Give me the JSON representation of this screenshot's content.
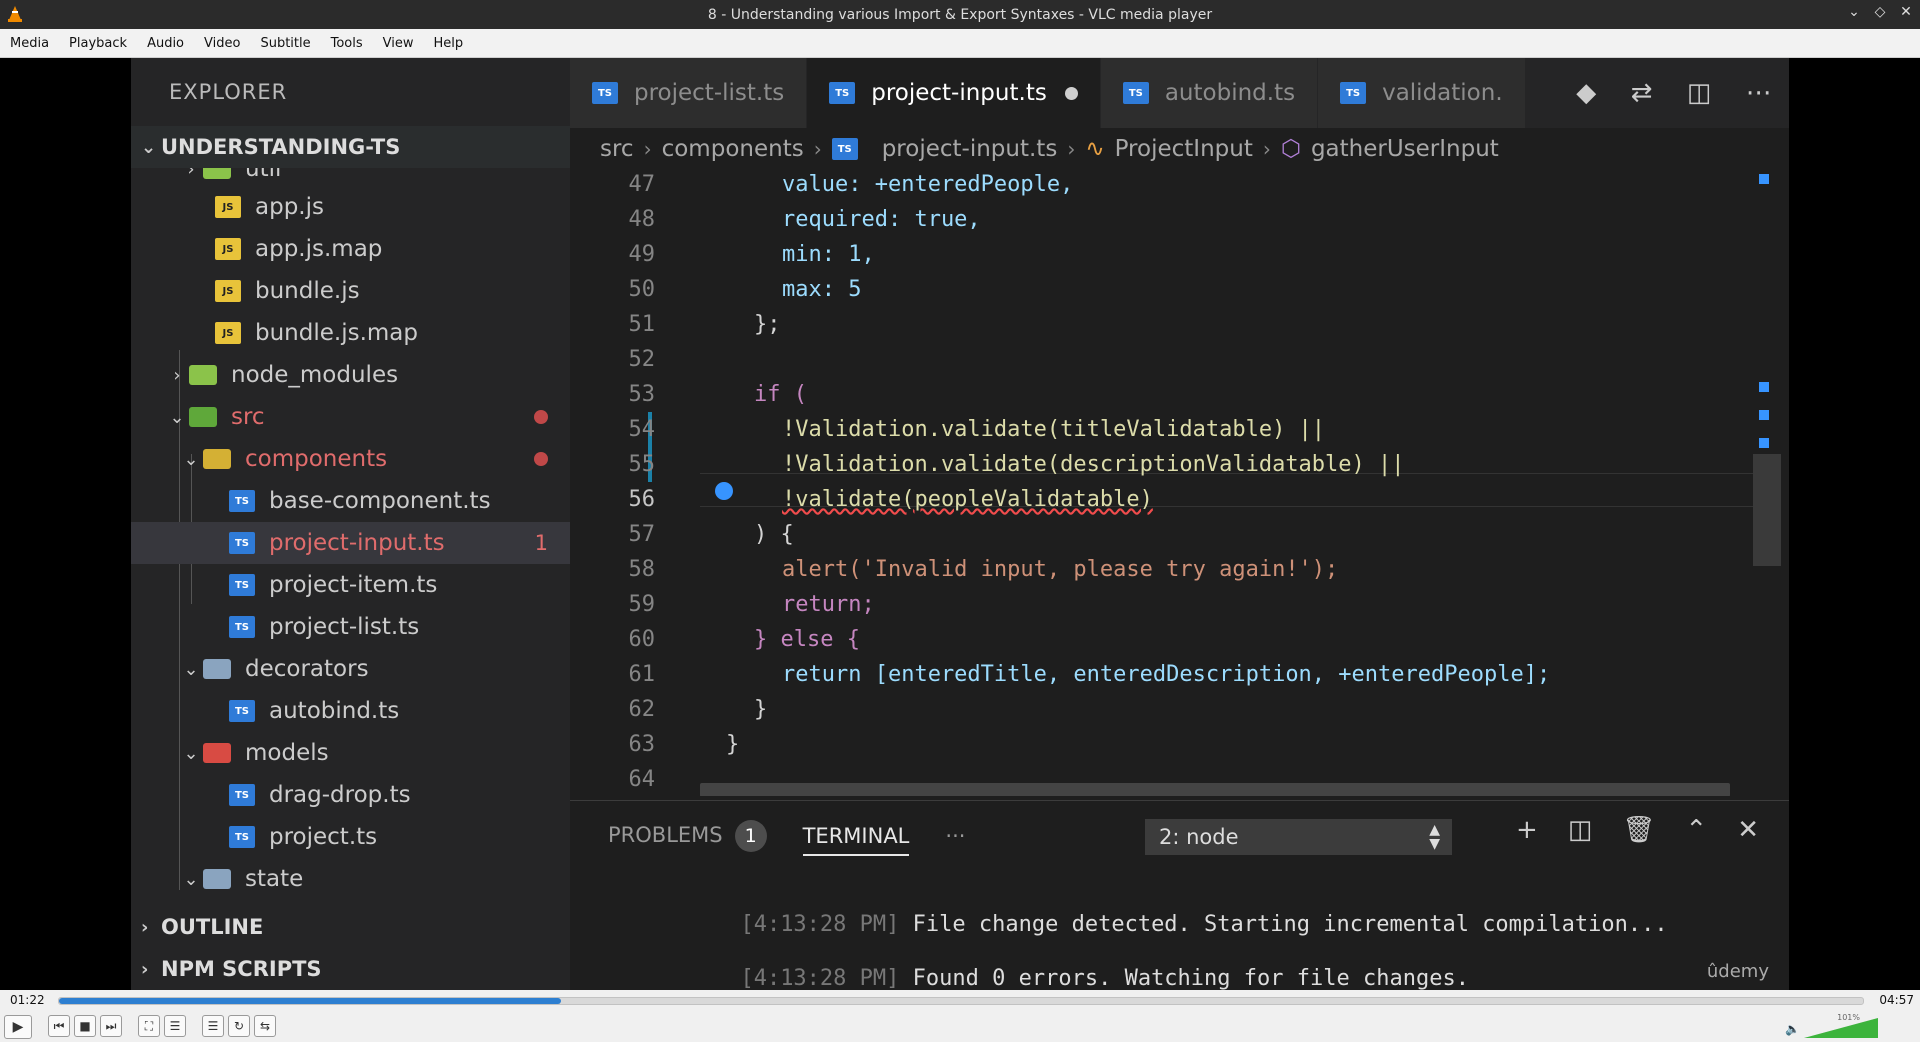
{
  "window": {
    "title": "8 - Understanding various Import & Export Syntaxes - VLC media player",
    "controls": [
      "⌄",
      "◇",
      "✕"
    ]
  },
  "menu": [
    "Media",
    "Playback",
    "Audio",
    "Video",
    "Subtitle",
    "Tools",
    "View",
    "Help"
  ],
  "explorer": {
    "title": "EXPLORER",
    "project": "UNDERSTANDING-TS",
    "items": [
      {
        "label": "util",
        "type": "folder"
      },
      {
        "label": "app.js",
        "type": "js"
      },
      {
        "label": "app.js.map",
        "type": "js"
      },
      {
        "label": "bundle.js",
        "type": "js"
      },
      {
        "label": "bundle.js.map",
        "type": "js"
      },
      {
        "label": "node_modules",
        "type": "folder"
      },
      {
        "label": "src",
        "type": "folder"
      },
      {
        "label": "components",
        "type": "folder"
      },
      {
        "label": "base-component.ts",
        "type": "ts"
      },
      {
        "label": "project-input.ts",
        "type": "ts",
        "errors": "1"
      },
      {
        "label": "project-item.ts",
        "type": "ts"
      },
      {
        "label": "project-list.ts",
        "type": "ts"
      },
      {
        "label": "decorators",
        "type": "folder"
      },
      {
        "label": "autobind.ts",
        "type": "ts"
      },
      {
        "label": "models",
        "type": "folder"
      },
      {
        "label": "drag-drop.ts",
        "type": "ts"
      },
      {
        "label": "project.ts",
        "type": "ts"
      },
      {
        "label": "state",
        "type": "folder"
      }
    ],
    "outline": "OUTLINE",
    "npm_scripts": "NPM SCRIPTS"
  },
  "tabs": [
    {
      "label": "project-list.ts",
      "active": false
    },
    {
      "label": "project-input.ts",
      "active": true
    },
    {
      "label": "autobind.ts",
      "active": false
    },
    {
      "label": "validation.",
      "active": false
    }
  ],
  "icon_labels": {
    "ts": "TS",
    "js": "JS"
  },
  "breadcrumb": [
    "src",
    "components",
    "project-input.ts",
    "ProjectInput",
    "gatherUserInput"
  ],
  "code": {
    "line_numbers": [
      "47",
      "48",
      "49",
      "50",
      "51",
      "52",
      "53",
      "54",
      "55",
      "56",
      "57",
      "58",
      "59",
      "60",
      "61",
      "62",
      "63",
      "64"
    ],
    "lines": [
      "value: +enteredPeople,",
      "required: true,",
      "min: 1,",
      "max: 5",
      "};",
      "",
      "if (",
      "!Validation.validate(titleValidatable) ||",
      "!Validation.validate(descriptionValidatable) ||",
      "!validate(peopleValidatable)",
      ") {",
      "alert('Invalid input, please try again!');",
      "return;",
      "} else {",
      "return [enteredTitle, enteredDescription, +enteredPeople];",
      "}",
      "}",
      ""
    ]
  },
  "panel": {
    "problems_label": "PROBLEMS",
    "problems_count": "1",
    "terminal_label": "TERMINAL",
    "more": "···",
    "terminal_select": "2: node",
    "terminal_lines": [
      {
        "time": "[4:13:28 PM]",
        "text": " File change detected. Starting incremental compilation..."
      },
      {
        "time": "[4:13:28 PM]",
        "text": " Found 0 errors. Watching for file changes."
      }
    ],
    "watermark": "ûdemy"
  },
  "player": {
    "elapsed": "01:22",
    "total": "04:57",
    "progress": 0.278,
    "volume_label": "101%",
    "volume": 1.01
  },
  "colors": {
    "accent": "#2d7fd1",
    "ts_icon": "#2f7bd8",
    "js_icon": "#e8c33a",
    "error": "#e06c6c"
  }
}
